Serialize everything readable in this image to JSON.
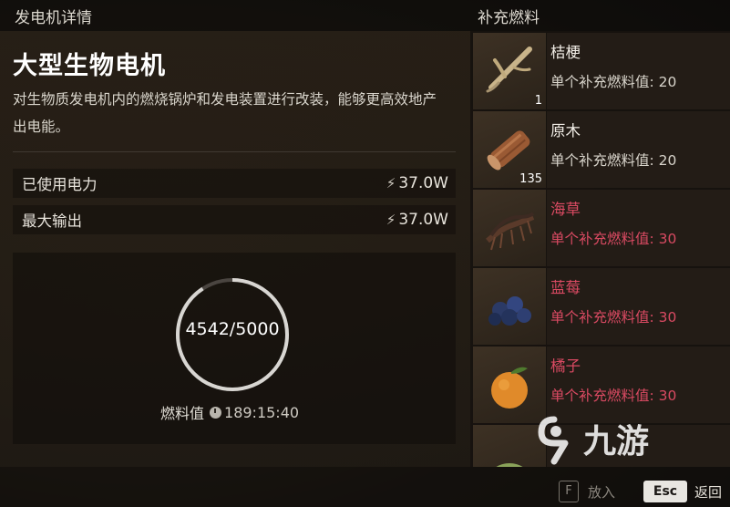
{
  "left_header": {
    "title": "发电机详情"
  },
  "generator": {
    "name": "大型生物电机",
    "description": "对生物质发电机内的燃烧锅炉和发电装置进行改装，能够更高效地产出电能。"
  },
  "stats": [
    {
      "label": "已使用电力",
      "value": "37.0W",
      "icon": "lightning-icon"
    },
    {
      "label": "最大输出",
      "value": "37.0W",
      "icon": "lightning-icon"
    }
  ],
  "fuel": {
    "current": 4542,
    "max": 5000,
    "display": "4542/5000",
    "label": "燃料值",
    "time": "189:15:40",
    "ring_color": "#d8d6d2"
  },
  "right_header": {
    "title": "补充燃料"
  },
  "fuel_items": [
    {
      "name": "桔梗",
      "value_text": "单个补充燃料值: 20",
      "count": "1",
      "icon": "platycodon-root-icon",
      "unavailable": false
    },
    {
      "name": "原木",
      "value_text": "单个补充燃料值: 20",
      "count": "135",
      "icon": "log-icon",
      "unavailable": false
    },
    {
      "name": "海草",
      "value_text": "单个补充燃料值: 30",
      "count": "",
      "icon": "seaweed-icon",
      "unavailable": true
    },
    {
      "name": "蓝莓",
      "value_text": "单个补充燃料值: 30",
      "count": "",
      "icon": "blueberry-icon",
      "unavailable": true
    },
    {
      "name": "橘子",
      "value_text": "单个补充燃料值: 30",
      "count": "",
      "icon": "orange-icon",
      "unavailable": true
    },
    {
      "name": "",
      "value_text": "",
      "count": "",
      "icon": "leaf-icon",
      "unavailable": true
    }
  ],
  "controls": {
    "put_key": "F",
    "put_label": "放入",
    "back_key": "Esc",
    "back_label": "返回"
  },
  "watermark": {
    "text": "九游",
    "icon": "watermark-9-icon"
  },
  "colors": {
    "unavailable": "#d94a62",
    "accent": "#e8e6e1"
  }
}
